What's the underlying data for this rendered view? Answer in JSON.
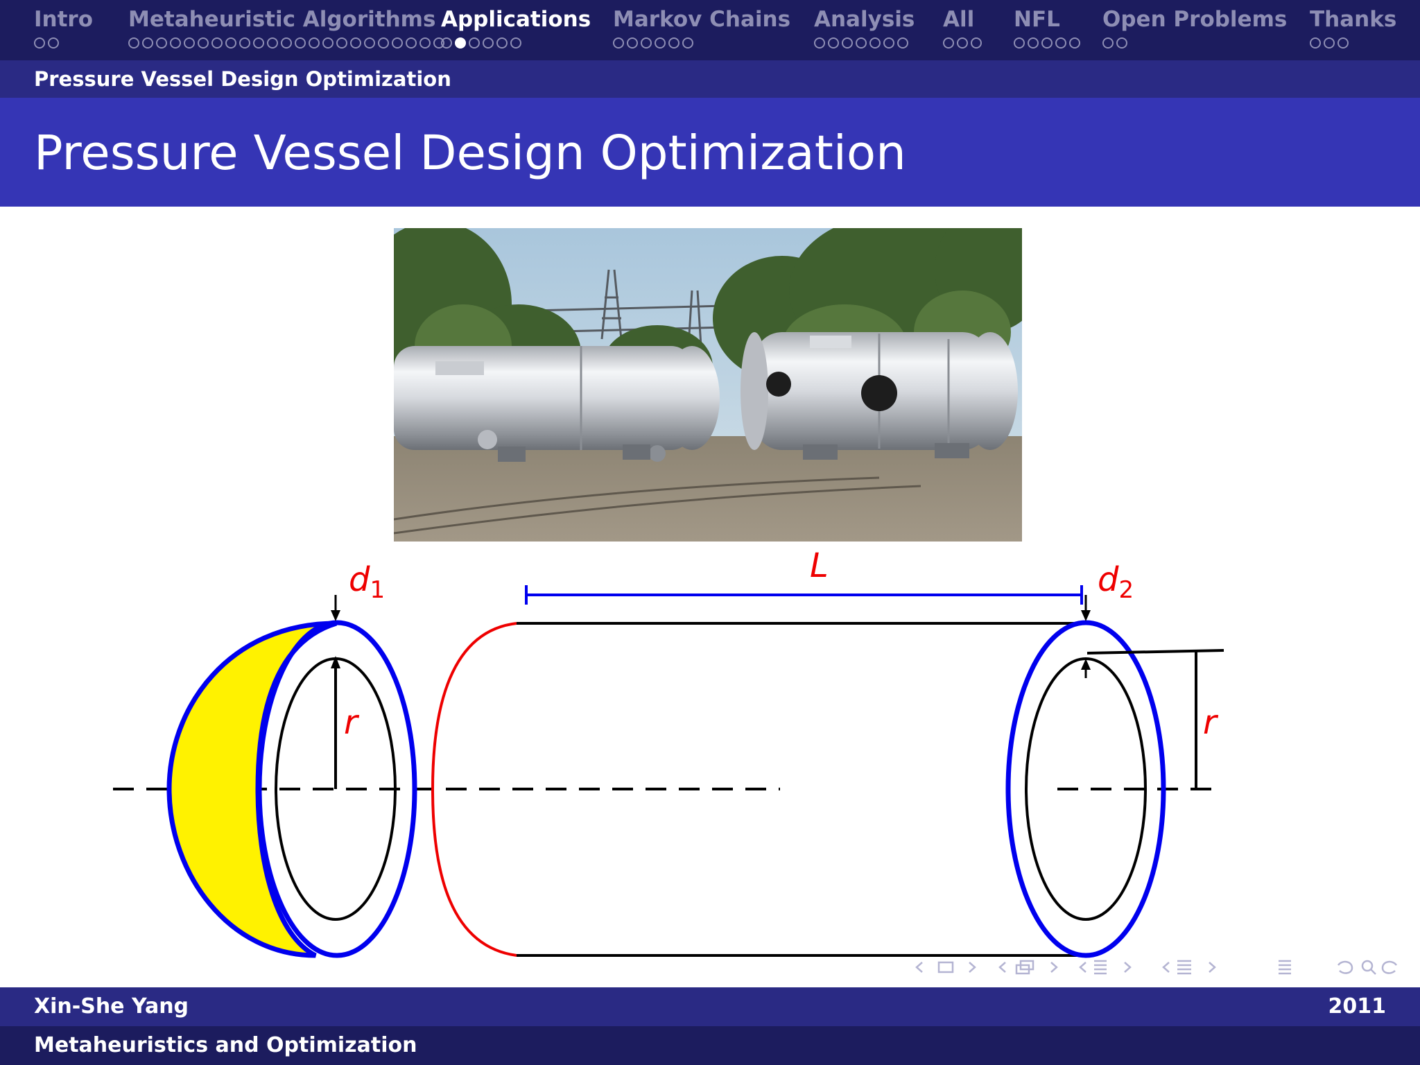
{
  "nav": {
    "sections": [
      {
        "label": "Intro",
        "dots": 2,
        "current": -1
      },
      {
        "label": "Metaheuristic Algorithms",
        "dots": 23,
        "current": -1
      },
      {
        "label": "Applications",
        "dots": 6,
        "current": 1
      },
      {
        "label": "Markov Chains",
        "dots": 6,
        "current": -1
      },
      {
        "label": "Analysis",
        "dots": 7,
        "current": -1
      },
      {
        "label": "All",
        "dots": 3,
        "current": -1
      },
      {
        "label": "NFL",
        "dots": 5,
        "current": -1
      },
      {
        "label": "Open Problems",
        "dots": 2,
        "current": -1
      },
      {
        "label": "Thanks",
        "dots": 3,
        "current": -1
      }
    ],
    "active_index": 2
  },
  "subsection": "Pressure Vessel Design Optimization",
  "title": "Pressure Vessel Design Optimization",
  "diagram": {
    "label_d1_base": "d",
    "label_d1_sub": "1",
    "label_d2_base": "d",
    "label_d2_sub": "2",
    "label_L": "L",
    "label_r_left": "r",
    "label_r_right": "r",
    "colors": {
      "shell": "#0000ee",
      "head_fill": "#fff200",
      "accent": "#ee0000",
      "line": "#000000"
    }
  },
  "footer": {
    "author": "Xin-She Yang",
    "year": "2011",
    "talk_title": "Metaheuristics and Optimization"
  }
}
